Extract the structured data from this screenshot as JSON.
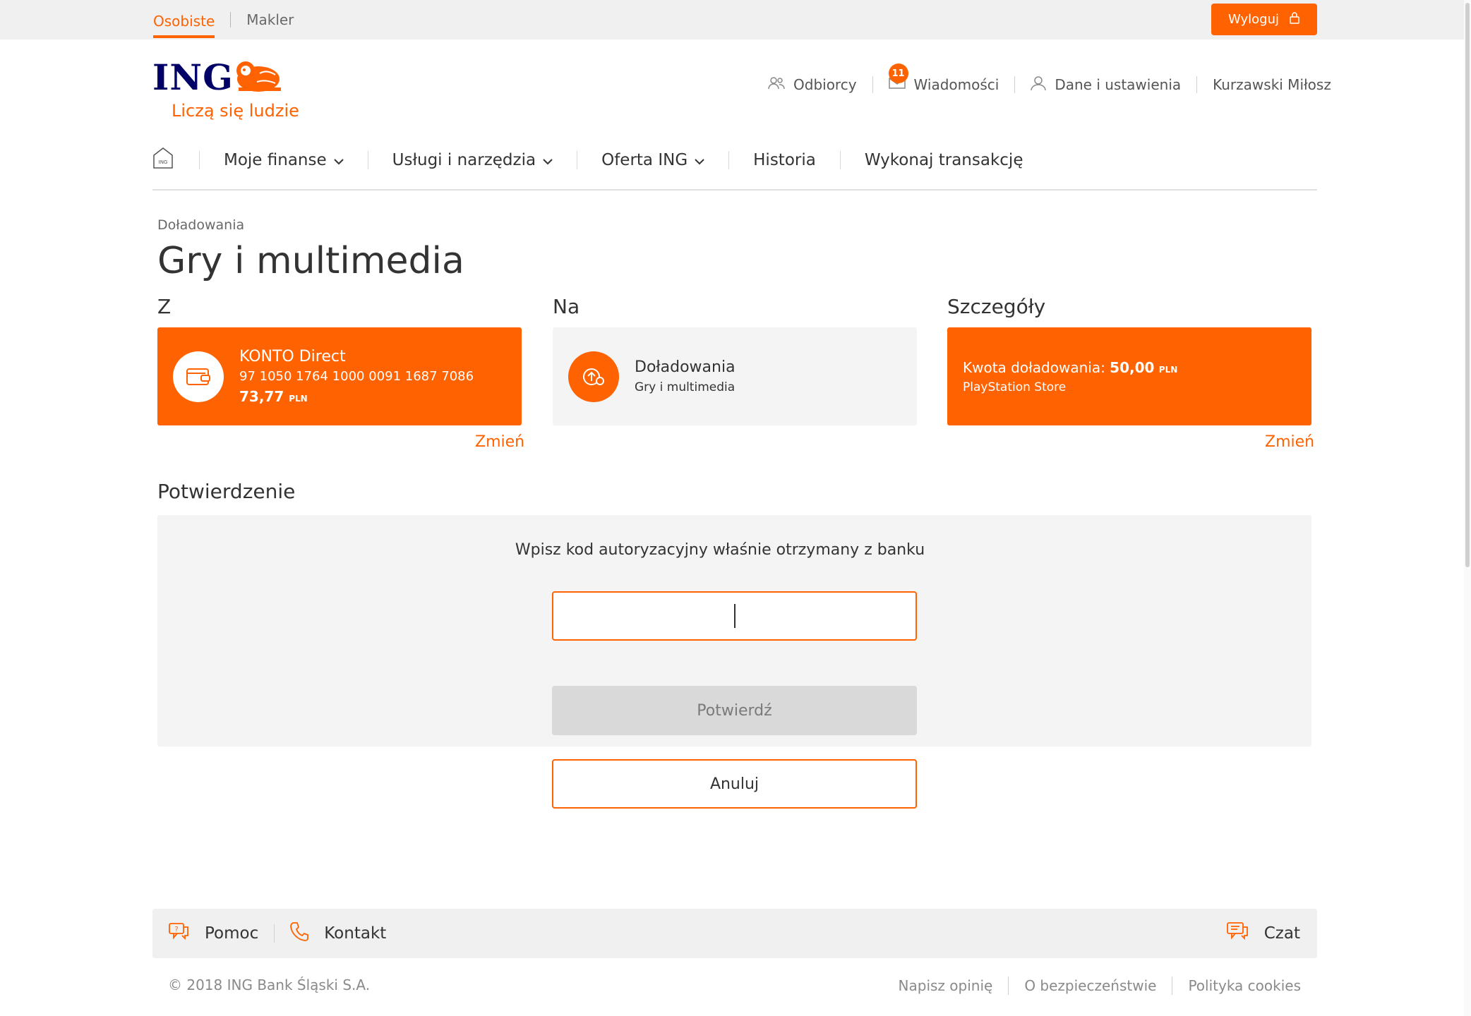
{
  "top_tabs": {
    "personal": "Osobiste",
    "broker": "Makler"
  },
  "logout": {
    "label": "Wyloguj"
  },
  "logo": {
    "brand": "ING",
    "tagline": "Liczą się ludzie"
  },
  "user_nav": {
    "recipients": "Odbiorcy",
    "messages": "Wiadomości",
    "messages_badge": "11",
    "settings": "Dane i ustawienia",
    "user_name": "Kurzawski Miłosz"
  },
  "main_nav": {
    "home_icon_text": "ING",
    "items": [
      "Moje finanse",
      "Usługi i narzędzia",
      "Oferta ING",
      "Historia",
      "Wykonaj transakcję"
    ]
  },
  "page": {
    "breadcrumb": "Doładowania",
    "title": "Gry i multimedia"
  },
  "columns": {
    "from": "Z",
    "to": "Na",
    "details": "Szczegóły"
  },
  "from_card": {
    "account_name": "KONTO Direct",
    "account_number": "97 1050 1764 1000 0091 1687 7086",
    "balance": "73,77",
    "currency": "PLN",
    "change": "Zmień"
  },
  "to_card": {
    "title": "Doładowania",
    "subtitle": "Gry i multimedia"
  },
  "details_card": {
    "amount_label": "Kwota doładowania:",
    "amount": "50,00",
    "currency": "PLN",
    "store": "PlayStation Store",
    "change": "Zmień"
  },
  "confirmation": {
    "title": "Potwierdzenie",
    "prompt": "Wpisz kod autoryzacyjny właśnie otrzymany z banku",
    "code_value": "",
    "confirm_button": "Potwierdź",
    "cancel_button": "Anuluj"
  },
  "help_bar": {
    "help": "Pomoc",
    "contact": "Kontakt",
    "chat": "Czat"
  },
  "footer": {
    "copyright": "© 2018 ING Bank Śląski S.A.",
    "links": [
      "Napisz opinię",
      "O bezpieczeństwie",
      "Polityka cookies"
    ]
  },
  "colors": {
    "accent": "#ff6200",
    "brand_navy": "#000066",
    "panel_grey": "#f4f4f4"
  }
}
